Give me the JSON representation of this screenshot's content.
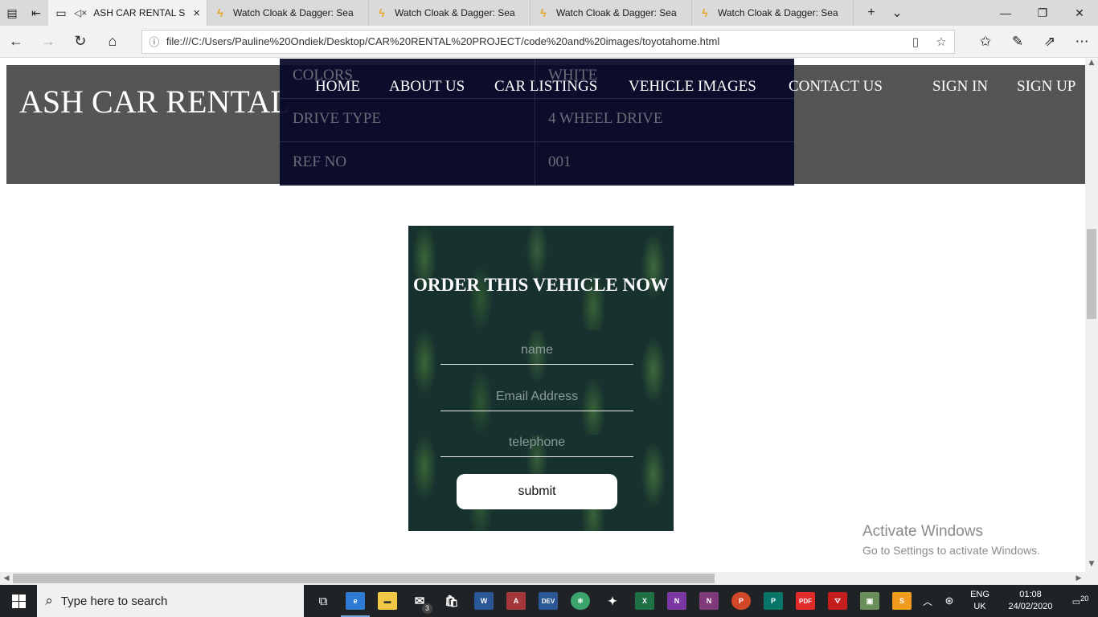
{
  "browser": {
    "tabs": [
      {
        "title": "ASH CAR RENTAL S",
        "active": true
      },
      {
        "title": "Watch Cloak & Dagger: Sea",
        "active": false
      },
      {
        "title": "Watch Cloak & Dagger: Sea",
        "active": false
      },
      {
        "title": "Watch Cloak & Dagger: Sea",
        "active": false
      },
      {
        "title": "Watch Cloak & Dagger: Sea",
        "active": false
      }
    ],
    "url": "file:///C:/Users/Pauline%20Ondiek/Desktop/CAR%20RENTAL%20PROJECT/code%20and%20images/toyotahome.html"
  },
  "site": {
    "logo": "ASH CAR RENTAL",
    "nav": [
      "HOME",
      "ABOUT US",
      "CAR LISTINGS",
      "VEHICLE IMAGES",
      "CONTACT US",
      "SIGN IN",
      "SIGN UP"
    ],
    "specs": [
      {
        "label": "COLORS",
        "value": "WHITE"
      },
      {
        "label": "DRIVE TYPE",
        "value": "4 WHEEL DRIVE"
      },
      {
        "label": "REF NO",
        "value": "001"
      }
    ],
    "order_form": {
      "title": "ORDER THIS VEHICLE NOW",
      "name_placeholder": "name",
      "email_placeholder": "Email Address",
      "telephone_placeholder": "telephone",
      "submit_label": "submit"
    }
  },
  "watermark": {
    "line1": "Activate Windows",
    "line2": "Go to Settings to activate Windows."
  },
  "taskbar": {
    "search_placeholder": "Type here to search",
    "mail_badge": "3",
    "lang_line1": "ENG",
    "lang_line2": "UK",
    "time": "01:08",
    "date": "24/02/2020",
    "notifications": "20",
    "app_colors": {
      "edge": "#2e7bd6",
      "explorer": "#f2c744",
      "word": "#2b5797",
      "access": "#a4373a",
      "excel": "#1e7145",
      "onenote": "#7b38a4",
      "powerpoint": "#d24726",
      "pdf": "#e22a2a",
      "sublime": "#f29c1f"
    }
  }
}
